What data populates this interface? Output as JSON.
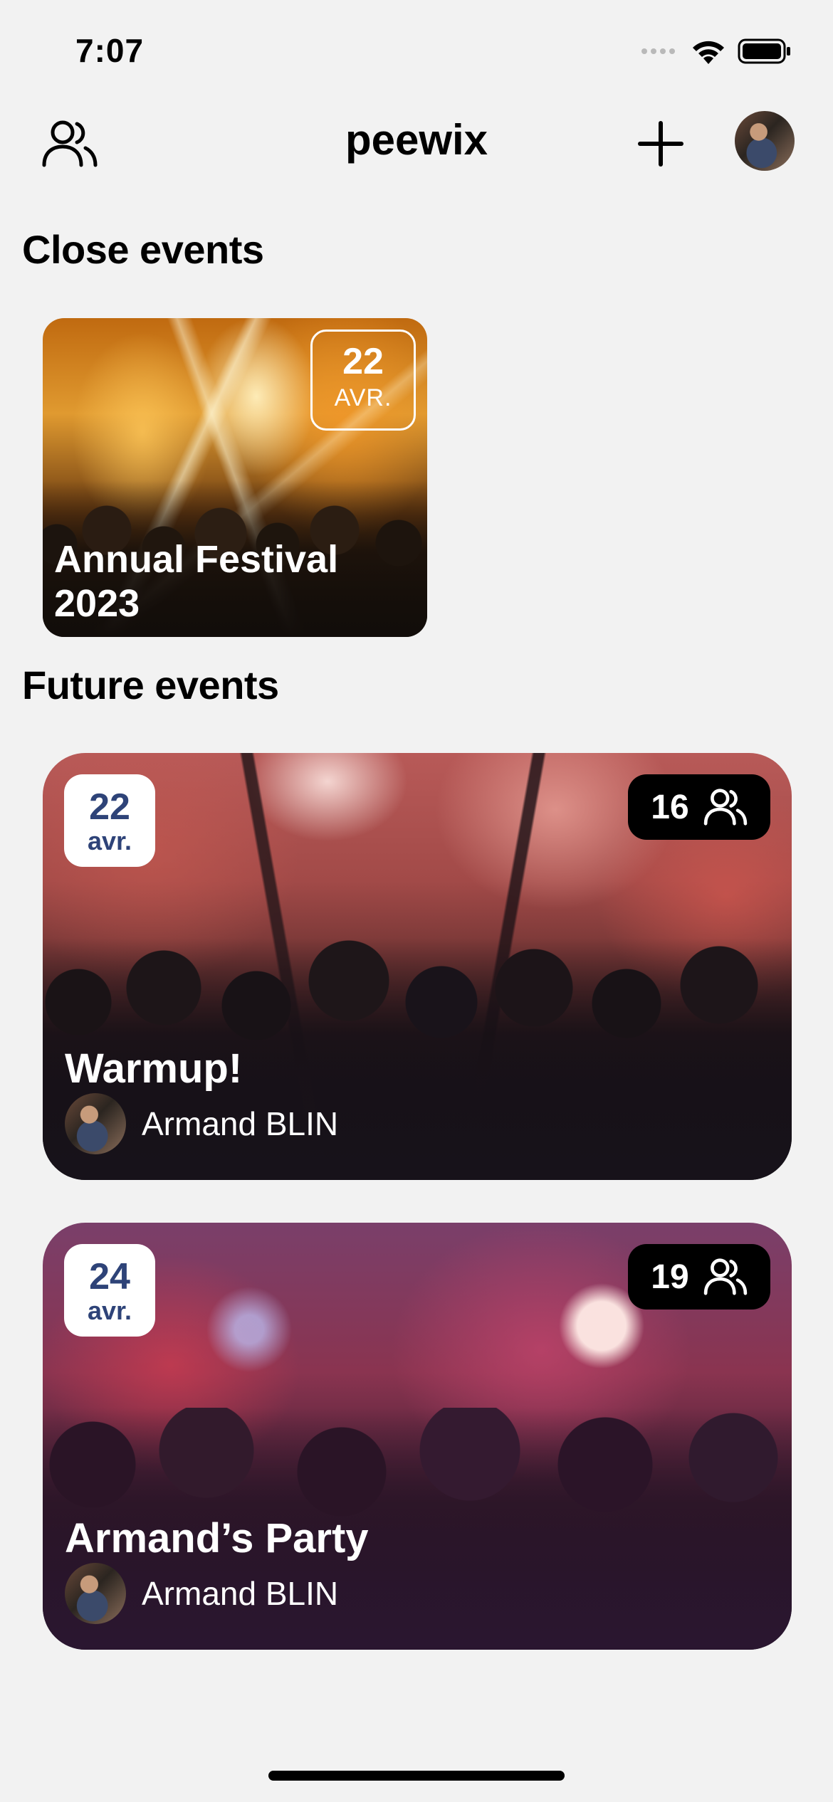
{
  "status_bar": {
    "time": "7:07"
  },
  "nav": {
    "title": "peewix",
    "icons": {
      "friends": "users-icon",
      "add": "plus-icon"
    }
  },
  "sections": {
    "close": "Close events",
    "future": "Future events"
  },
  "close_events": [
    {
      "day": "22",
      "month": "AVR.",
      "title": "Annual Festival 2023"
    }
  ],
  "future_events": [
    {
      "day": "22",
      "month": "avr.",
      "attendees": "16",
      "title": "Warmup!",
      "organizer": "Armand BLIN"
    },
    {
      "day": "24",
      "month": "avr.",
      "attendees": "19",
      "title": "Armand’s Party",
      "organizer": "Armand BLIN"
    }
  ],
  "colors": {
    "background": "#f2f2f2",
    "date_chip_text": "#2e4378",
    "attendee_chip_bg": "#000000"
  }
}
